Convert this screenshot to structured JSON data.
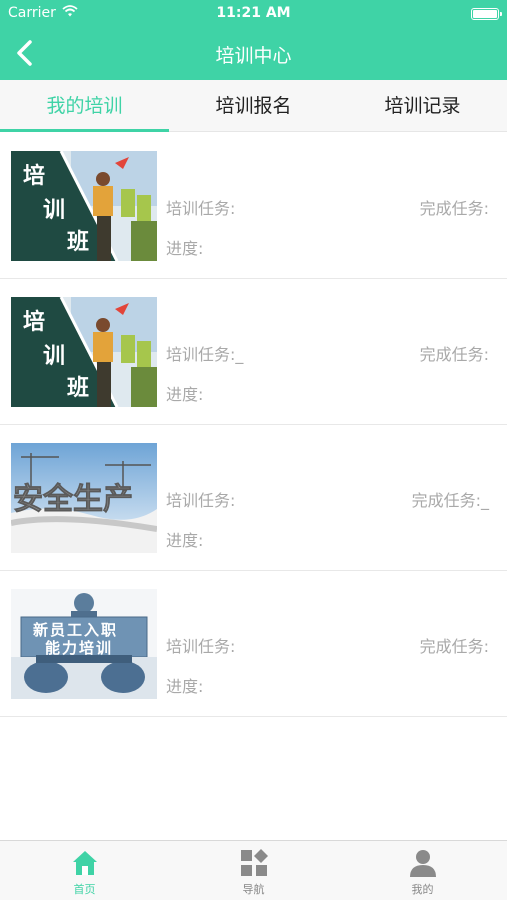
{
  "status_bar": {
    "carrier": "Carrier",
    "time": "11:21 AM"
  },
  "nav": {
    "title": "培训中心",
    "back_icon": "chevron-left-icon"
  },
  "tabs": [
    {
      "label": "我的培训",
      "active": true
    },
    {
      "label": "培训报名",
      "active": false
    },
    {
      "label": "培训记录",
      "active": false
    }
  ],
  "list": [
    {
      "image_text": [
        "培",
        "训",
        "班"
      ],
      "task_label": "培训任务:",
      "done_label": "完成任务:",
      "progress_label": "进度:"
    },
    {
      "image_text": [
        "培",
        "训",
        "班"
      ],
      "task_label": "培训任务:_",
      "done_label": "完成任务:",
      "progress_label": "进度:"
    },
    {
      "image_text": [
        "安全生产"
      ],
      "task_label": "培训任务:",
      "done_label": "完成任务:_",
      "progress_label": "进度:"
    },
    {
      "image_text": [
        "新员工入职",
        "能力培训"
      ],
      "task_label": "培训任务:",
      "done_label": "完成任务:",
      "progress_label": "进度:"
    }
  ],
  "tabbar": [
    {
      "label": "首页",
      "icon": "home-icon",
      "active": true
    },
    {
      "label": "导航",
      "icon": "grid-icon",
      "active": false
    },
    {
      "label": "我的",
      "icon": "person-icon",
      "active": false
    }
  ],
  "colors": {
    "accent": "#3fd3a6",
    "muted_text": "#a9a9a9"
  }
}
